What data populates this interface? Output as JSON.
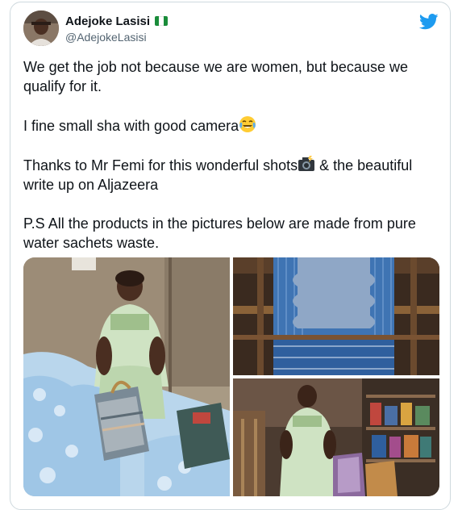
{
  "tweet": {
    "author": {
      "display_name": "Adejoke Lasisi",
      "handle": "@AdejokeLasisi",
      "flag_icon": "nigeria-flag-icon",
      "avatar_icon": "profile-avatar"
    },
    "logo_icon": "twitter-bird-icon",
    "brand_color": "#1d9bf0",
    "paragraphs": {
      "p1": "We get the job not because we are women, but because we qualify for it.",
      "p2": "I fine small sha with good camera",
      "p3_before_emoji": "Thanks to Mr Femi for this wonderful shots",
      "p3_after_emoji": " & the beautiful write up on Aljazeera",
      "p4": "P.S All the products in the pictures below are made from pure water sachets waste."
    },
    "emojis": {
      "laughing": "face-with-tears-of-joy-emoji",
      "camera": "camera-with-flash-emoji"
    },
    "media": [
      {
        "icon": "photo-woman-seated-with-sachet-bags"
      },
      {
        "icon": "photo-loom-weaving-blue-fabric"
      },
      {
        "icon": "photo-woman-in-workshop-with-bags"
      }
    ]
  }
}
